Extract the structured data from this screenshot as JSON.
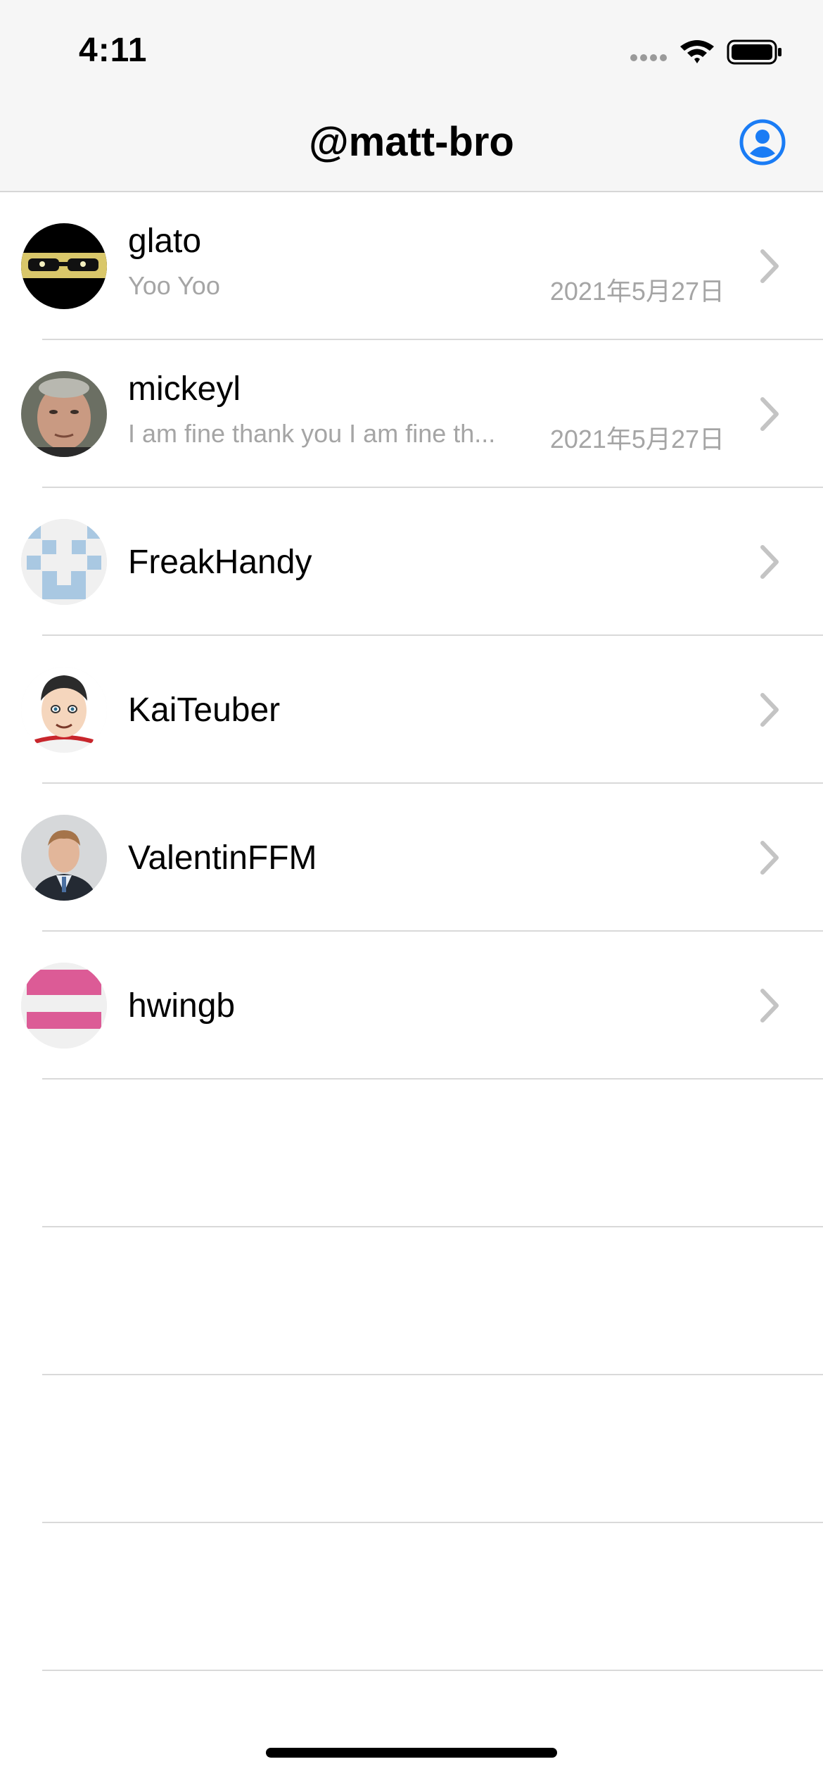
{
  "status_bar": {
    "time": "4:11",
    "icons": [
      "signal-dots-icon",
      "wifi-icon",
      "battery-icon"
    ]
  },
  "nav": {
    "title": "@matt-bro",
    "profile_icon": "person-circle-icon"
  },
  "colors": {
    "accent": "#1a7cf5",
    "secondary_text": "#a5a5a5",
    "separator": "#d9d9d9",
    "bar_bg": "#f6f6f6"
  },
  "conversations": [
    {
      "name": "glato",
      "preview": "Yoo Yoo",
      "date": "2021年5月27日",
      "avatar": "avatar-glato"
    },
    {
      "name": "mickeyl",
      "preview": "I am fine thank you I am fine th...",
      "date": "2021年5月27日",
      "avatar": "avatar-mickeyl"
    },
    {
      "name": "FreakHandy",
      "preview": "",
      "date": "",
      "avatar": "avatar-freakhandy"
    },
    {
      "name": "KaiTeuber",
      "preview": "",
      "date": "",
      "avatar": "avatar-kaiteuber"
    },
    {
      "name": "ValentinFFM",
      "preview": "",
      "date": "",
      "avatar": "avatar-valentinffm"
    },
    {
      "name": "hwingb",
      "preview": "",
      "date": "",
      "avatar": "avatar-hwingb"
    }
  ]
}
